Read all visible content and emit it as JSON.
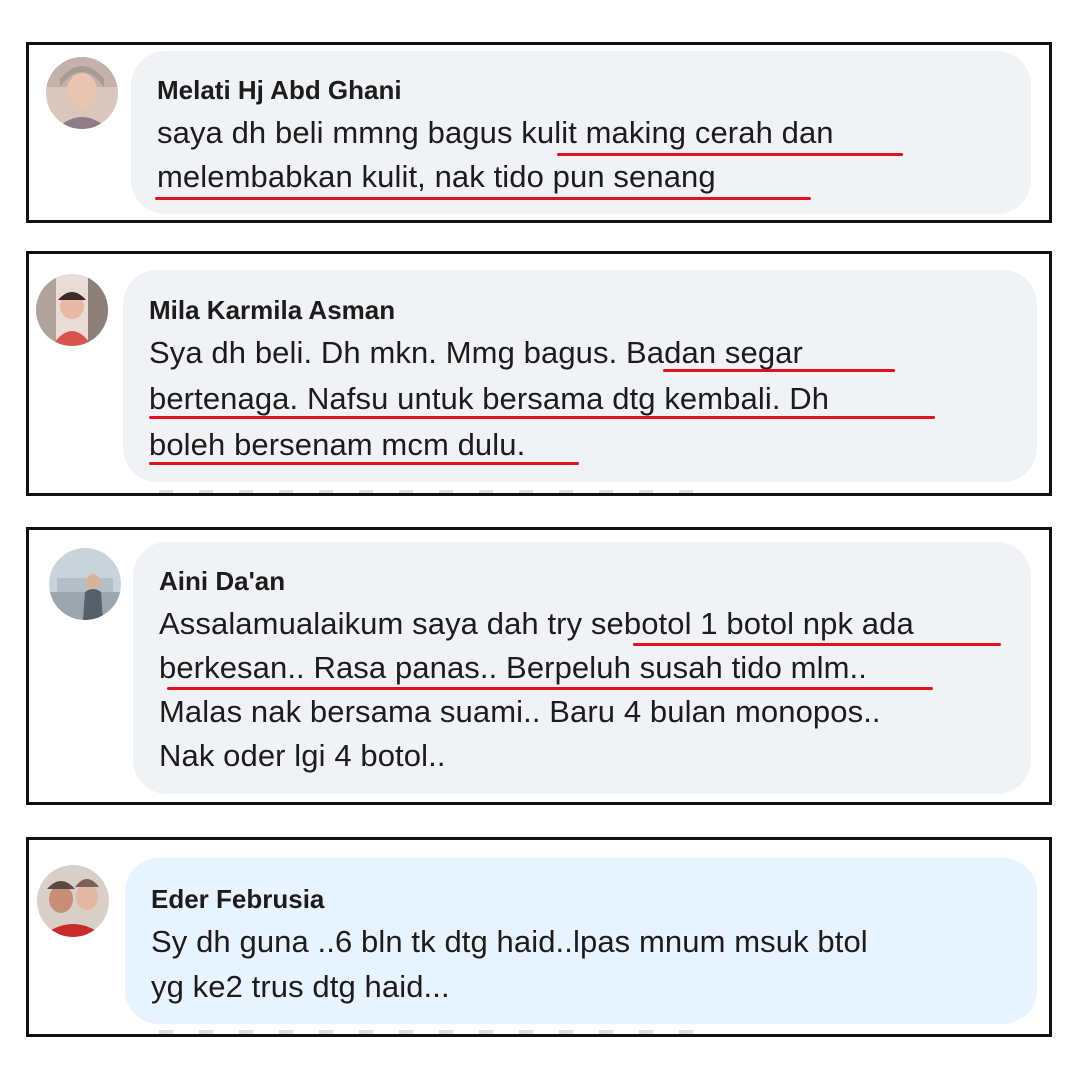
{
  "colors": {
    "bubble_gray": "#f0f2f5",
    "bubble_blue": "#e7f3ff",
    "underline_red": "#e0121f",
    "frame_black": "#111111"
  },
  "comments": [
    {
      "author": "Melati Hj Abd Ghani",
      "lines": [
        "saya dh beli mmng bagus kulit making cerah dan",
        "melembabkan kulit, nak tido pun senang"
      ],
      "avatar_icon": "profile-photo-icon"
    },
    {
      "author": "Mila Karmila Asman",
      "lines": [
        "Sya dh beli. Dh mkn. Mmg bagus. Badan segar",
        "bertenaga. Nafsu untuk bersama dtg kembali. Dh",
        "boleh bersenam mcm dulu."
      ],
      "avatar_icon": "profile-photo-icon"
    },
    {
      "author": "Aini Da'an",
      "lines": [
        "Assalamualaikum saya dah try sebotol 1 botol npk ada",
        "berkesan.. Rasa panas.. Berpeluh susah tido mlm..",
        "Malas nak bersama suami.. Baru 4 bulan monopos..",
        "Nak oder lgi 4 botol.."
      ],
      "avatar_icon": "profile-photo-icon"
    },
    {
      "author": "Eder Februsia",
      "lines": [
        "Sy dh guna ..6 bln tk dtg haid..lpas mnum msuk btol",
        "yg ke2 trus dtg haid..."
      ],
      "avatar_icon": "profile-photo-icon"
    }
  ]
}
